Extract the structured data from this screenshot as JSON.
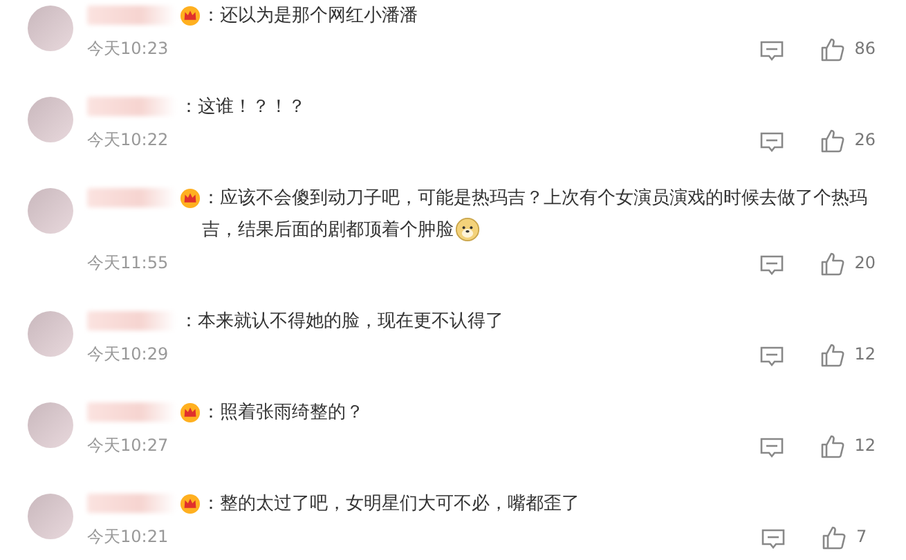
{
  "comments": [
    {
      "vip": true,
      "text": "：还以为是那个网红小潘潘",
      "emoji": false,
      "time": "今天10:23",
      "likes": "86"
    },
    {
      "vip": false,
      "text": "：这谁！？！？",
      "emoji": false,
      "time": "今天10:22",
      "likes": "26"
    },
    {
      "vip": true,
      "text": "：应该不会傻到动刀子吧，可能是热玛吉？上次有个女演员演戏的时候去做了个热玛吉，结果后面的剧都顶着个肿脸",
      "emoji": true,
      "time": "今天11:55",
      "likes": "20"
    },
    {
      "vip": false,
      "text": "：本来就认不得她的脸，现在更不认得了",
      "emoji": false,
      "time": "今天10:29",
      "likes": "12"
    },
    {
      "vip": true,
      "text": "：照着张雨绮整的？",
      "emoji": false,
      "time": "今天10:27",
      "likes": "12"
    },
    {
      "vip": true,
      "text": "：整的太过了吧，女明星们大可不必，嘴都歪了",
      "emoji": false,
      "time": "今天10:21",
      "likes": "7"
    }
  ]
}
